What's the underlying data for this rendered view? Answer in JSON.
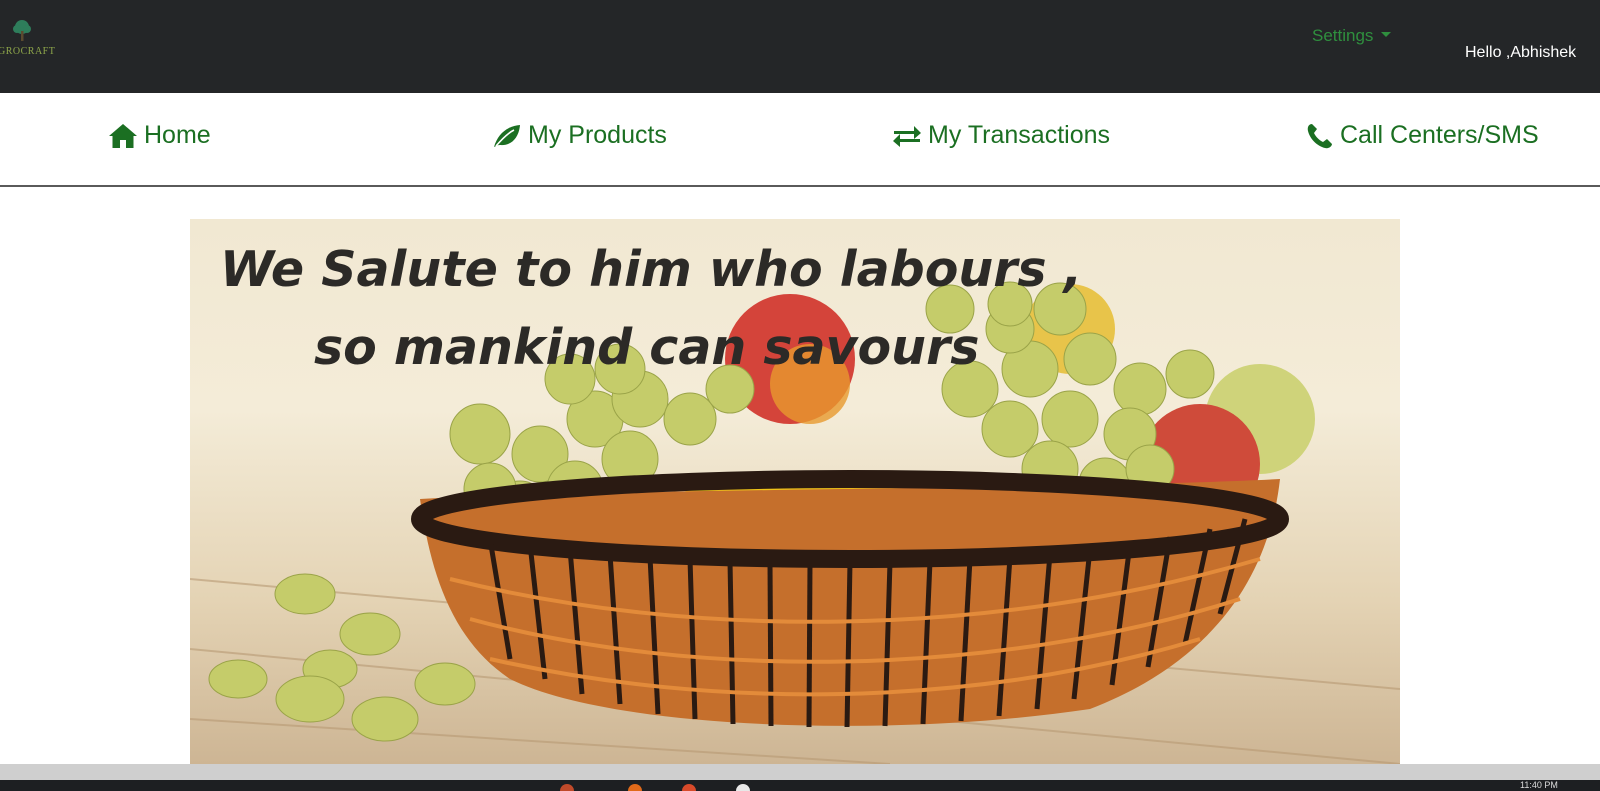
{
  "brand": {
    "logo_text": "GROCRAFT",
    "logo_icon": "tree-icon",
    "color": "#8ea64a"
  },
  "header": {
    "settings_label": "Settings",
    "greeting": "Hello ,Abhishek"
  },
  "nav": {
    "items": [
      {
        "label": "Home",
        "icon": "home-icon"
      },
      {
        "label": "My Products",
        "icon": "leaf-icon"
      },
      {
        "label": "My Transactions",
        "icon": "exchange-icon"
      },
      {
        "label": "Call Centers/SMS",
        "icon": "phone-icon"
      }
    ],
    "color": "#1b6f22"
  },
  "hero": {
    "line1": "We Salute to him who labours ,",
    "line2": "so mankind can savours",
    "image_icon": "fruit-basket-image"
  },
  "taskbar": {
    "time": "11:40 PM"
  },
  "colors": {
    "topbar": "#242628",
    "settings": "#2f8f3e",
    "accent_green": "#1b6f22"
  }
}
